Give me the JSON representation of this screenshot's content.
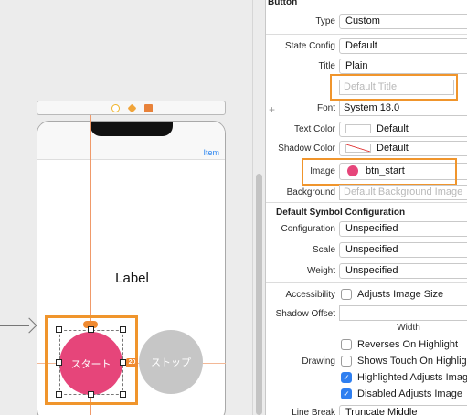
{
  "canvas": {
    "nav_item": "Item",
    "label_text": "Label",
    "start_button_title": "スタート",
    "stop_button_title": "ストップ",
    "spacing_badge": "20"
  },
  "inspector": {
    "section_title": "Button",
    "rows": {
      "type": {
        "label": "Type",
        "value": "Custom"
      },
      "state_config": {
        "label": "State Config",
        "value": "Default"
      },
      "title": {
        "label": "Title",
        "value": "Plain"
      },
      "title_text": {
        "placeholder": "Default Title"
      },
      "font": {
        "label": "Font",
        "value": "System 18.0"
      },
      "text_color": {
        "label": "Text Color",
        "value": "Default"
      },
      "shadow_color": {
        "label": "Shadow Color",
        "value": "Default"
      },
      "image": {
        "label": "Image",
        "value": "btn_start"
      },
      "background": {
        "label": "Background",
        "placeholder": "Default Background Image"
      }
    },
    "symbol_section_title": "Default Symbol Configuration",
    "symbol_rows": {
      "configuration": {
        "label": "Configuration",
        "value": "Unspecified"
      },
      "scale": {
        "label": "Scale",
        "value": "Unspecified"
      },
      "weight": {
        "label": "Weight",
        "value": "Unspecified"
      }
    },
    "accessibility": {
      "label": "Accessibility",
      "checkbox": "Adjusts Image Size",
      "checked": false
    },
    "shadow_offset": {
      "label": "Shadow Offset",
      "sublabel": "Width"
    },
    "drawing": {
      "label": "Drawing",
      "options": [
        {
          "text": "Reverses On Highlight",
          "checked": false
        },
        {
          "text": "Shows Touch On Highlight",
          "checked": false
        },
        {
          "text": "Highlighted Adjusts Image",
          "checked": true
        },
        {
          "text": "Disabled Adjusts Image",
          "checked": true
        }
      ]
    },
    "line_break": {
      "label": "Line Break",
      "value": "Truncate Middle"
    }
  },
  "colors": {
    "highlight": "#f0952c",
    "start_button": "#e6457a",
    "stop_button": "#c6c6c6",
    "checkbox_on": "#2f7ff0"
  }
}
